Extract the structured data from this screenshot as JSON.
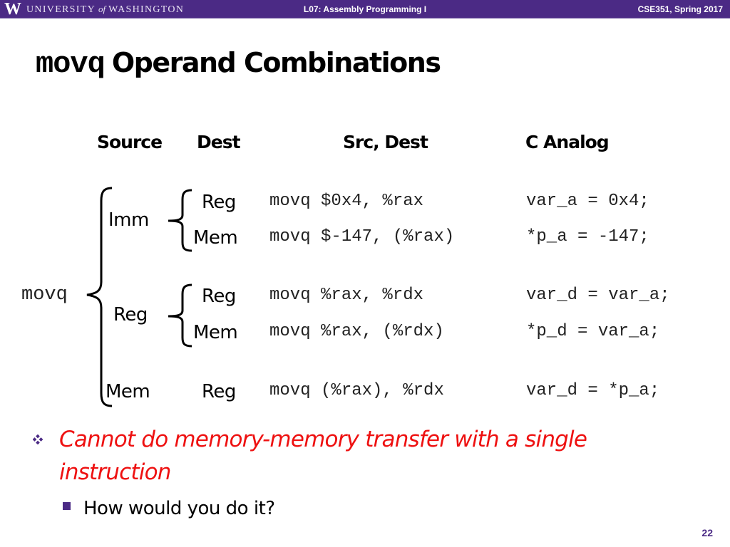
{
  "header": {
    "logo_letter": "W",
    "university_part1": "UNIVERSITY",
    "university_of": "of",
    "university_part2": "WASHINGTON",
    "lecture": "L07: Assembly Programming I",
    "course": "CSE351, Spring 2017"
  },
  "title": {
    "code_part": "movq",
    "text_part": "Operand Combinations"
  },
  "table": {
    "headers": {
      "source": "Source",
      "dest": "Dest",
      "src_dest": "Src, Dest",
      "c_analog": "C Analog"
    },
    "root_label": "movq",
    "sources": [
      "Imm",
      "Reg",
      "Mem"
    ],
    "rows": [
      {
        "source": "Imm",
        "dest": "Reg",
        "asm": "movq $0x4, %rax",
        "c": "var_a = 0x4;"
      },
      {
        "source": "Imm",
        "dest": "Mem",
        "asm": "movq $-147, (%rax)",
        "c": "*p_a = -147;"
      },
      {
        "source": "Reg",
        "dest": "Reg",
        "asm": "movq %rax, %rdx",
        "c": "var_d = var_a;"
      },
      {
        "source": "Reg",
        "dest": "Mem",
        "asm": "movq %rax, (%rdx)",
        "c": "*p_d = var_a;"
      },
      {
        "source": "Mem",
        "dest": "Reg",
        "asm": "movq (%rax), %rdx",
        "c": "var_d = *p_a;"
      }
    ]
  },
  "bullets": [
    {
      "icon": "diamond-cluster-bullet",
      "text": "Cannot do memory-memory transfer with a single instruction",
      "color": "#ee1111"
    },
    {
      "icon": "square-bullet",
      "text": "How would you do it?",
      "color": "#000000"
    }
  ],
  "colors": {
    "brand_purple": "#4b2a85",
    "emphasis_red": "#ee1111"
  },
  "page_number": "22"
}
